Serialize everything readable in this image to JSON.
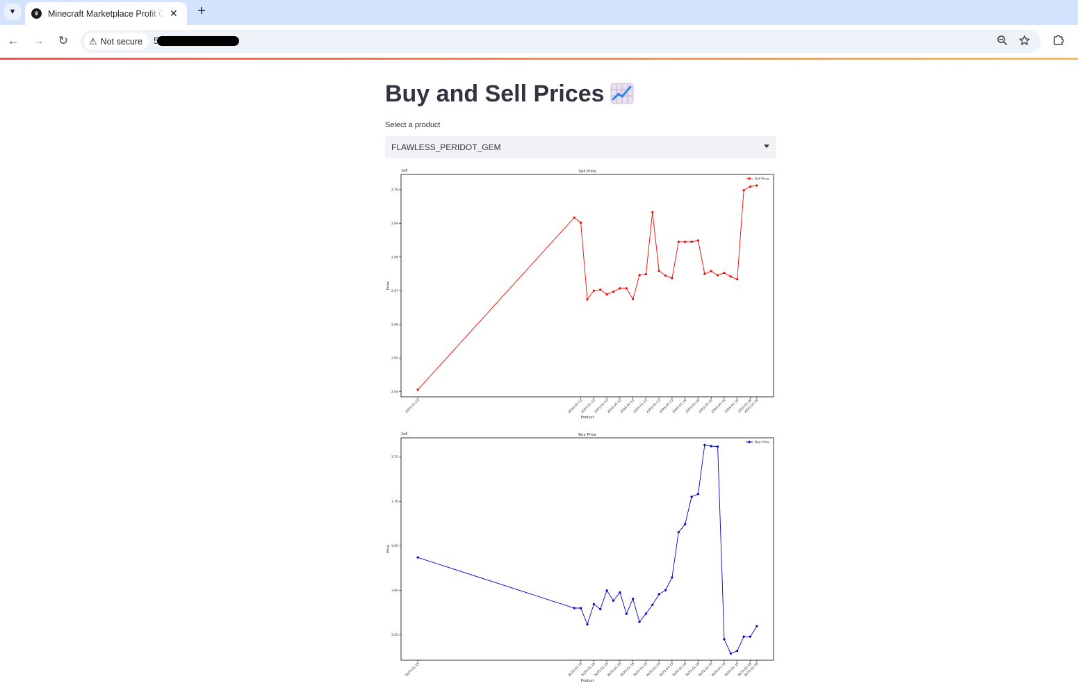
{
  "browser": {
    "tab_title": "Minecraft Marketplace Profit Ca",
    "security_label": "Not secure",
    "url_visible": "5",
    "icons": {
      "tab_menu": "chevron-down-icon",
      "favicon": "crown-icon",
      "close": "close-icon",
      "new_tab": "plus-icon",
      "back": "arrow-left-icon",
      "forward": "arrow-right-icon",
      "reload": "reload-icon",
      "warning": "warning-icon",
      "zoom": "zoom-out-icon",
      "bookmark": "star-icon",
      "extensions": "puzzle-icon"
    }
  },
  "page": {
    "title": "Buy and Sell Prices",
    "title_emoji": "📈",
    "select_label": "Select a product",
    "selected_product": "FLAWLESS_PERIDOT_GEM"
  },
  "chart_data": [
    {
      "type": "line",
      "title": "Sell Price",
      "xlabel": "Product",
      "ylabel": "Price",
      "offset_label": "1e6",
      "color": "#ff0000",
      "legend": "top-right",
      "grid": false,
      "ylim": [
        2.6385,
        2.7045
      ],
      "yticks": [
        2.64,
        2.65,
        2.66,
        2.67,
        2.68,
        2.69,
        2.7
      ],
      "ytick_labels": [
        "2.64",
        "2.65",
        "2.66",
        "2.67",
        "2.68",
        "2.69",
        "2.70"
      ],
      "x_slots": 53,
      "point_slots": [
        0,
        24,
        25,
        26,
        27,
        28,
        29,
        30,
        31,
        32,
        33,
        34,
        35,
        36,
        37,
        38,
        39,
        40,
        41,
        42,
        43,
        44,
        45,
        46,
        47,
        48,
        49,
        50,
        51,
        52
      ],
      "tick_slots": [
        0,
        25,
        27,
        29,
        31,
        33,
        35,
        37,
        39,
        41,
        43,
        45,
        47,
        49,
        51,
        52
      ],
      "tick_labels": [
        "2025-01-15",
        "2025-01-15",
        "2025-01-15",
        "2025-01-15",
        "2025-01-15",
        "2025-01-15",
        "2025-01-15",
        "2025-01-15",
        "2025-01-15",
        "2025-01-16",
        "2025-01-16",
        "2025-01-16",
        "2025-01-16",
        "2025-01-16",
        "2025-01-16",
        "2025-01-16"
      ],
      "series": [
        {
          "name": "Sell Price",
          "values": [
            2.6406,
            2.6917,
            2.6902,
            2.6674,
            2.67,
            2.6703,
            2.6689,
            2.6697,
            2.6707,
            2.6707,
            2.6675,
            2.6746,
            2.6749,
            2.6933,
            2.6759,
            2.6745,
            2.6737,
            2.6845,
            2.6845,
            2.6845,
            2.6849,
            2.675,
            2.6758,
            2.6746,
            2.6753,
            2.6742,
            2.6734,
            2.6998,
            2.7009,
            2.7012
          ]
        }
      ]
    },
    {
      "type": "line",
      "title": "Buy Price",
      "xlabel": "Product",
      "ylabel": "Price",
      "offset_label": "1e6",
      "color": "#0000cc",
      "legend": "top-right",
      "grid": false,
      "ylim": [
        3.5215,
        3.7715
      ],
      "yticks": [
        3.55,
        3.6,
        3.65,
        3.7,
        3.75
      ],
      "ytick_labels": [
        "3.55",
        "3.60",
        "3.65",
        "3.70",
        "3.75"
      ],
      "x_slots": 53,
      "point_slots": [
        0,
        24,
        25,
        26,
        27,
        28,
        29,
        30,
        31,
        32,
        33,
        34,
        35,
        36,
        37,
        38,
        39,
        40,
        41,
        42,
        43,
        44,
        45,
        46,
        47,
        48,
        49,
        50,
        51,
        52
      ],
      "tick_slots": [
        0,
        25,
        27,
        29,
        31,
        33,
        35,
        37,
        39,
        41,
        43,
        45,
        47,
        49,
        51,
        52
      ],
      "tick_labels": [
        "2025-01-15",
        "2025-01-15",
        "2025-01-15",
        "2025-01-15",
        "2025-01-15",
        "2025-01-15",
        "2025-01-15",
        "2025-01-15",
        "2025-01-15",
        "2025-01-16",
        "2025-01-16",
        "2025-01-16",
        "2025-01-16",
        "2025-01-16",
        "2025-01-16",
        "2025-01-16"
      ],
      "series": [
        {
          "name": "Buy Price",
          "values": [
            3.637,
            3.5801,
            3.5801,
            3.5617,
            3.5845,
            3.5788,
            3.5998,
            3.5885,
            3.5977,
            3.5736,
            3.5905,
            3.5647,
            3.5738,
            3.5838,
            3.5957,
            3.6002,
            3.6145,
            3.6654,
            3.6744,
            3.7052,
            3.7083,
            3.7634,
            3.7621,
            3.7617,
            3.545,
            3.529,
            3.532,
            3.548,
            3.548,
            3.5598
          ]
        }
      ]
    }
  ]
}
